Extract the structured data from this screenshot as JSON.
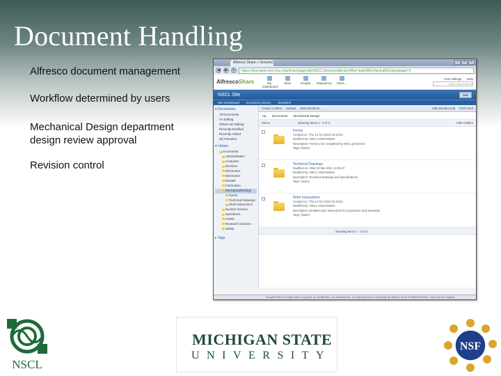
{
  "slide": {
    "title": "Document Handling",
    "bullets": [
      "Alfresco document management",
      "Workflow determined by users",
      "Mechanical Design department design review approval",
      "Revision control"
    ]
  },
  "screenshot": {
    "browser_tab": "Alfresco Share » Docume...",
    "address": "https://docmgmt.nscl.msu.edu/share/page/site/NSCL/documentlibrary#filter=path|/Mechanical/Design&page=1",
    "app_logo": "Alfresco",
    "app_logo_accent": "Share",
    "app_nav": [
      "My Dashboard",
      "Sites",
      "People",
      "Repository",
      "More..."
    ],
    "user_label": "chris stillings",
    "help_label": "Help",
    "search_placeholder": "Enter search terms",
    "site_title": "NSCL Site",
    "join_label": "Join",
    "site_nav": [
      "Site Dashboard",
      "Document Library",
      "Members"
    ],
    "sidebar": {
      "documents_header": "Documents",
      "documents_items": [
        "All Documents",
        "I'm Editing",
        "Others are Editing",
        "Recently Modified",
        "Recently Added",
        "My Favorites"
      ],
      "library_header": "Library",
      "library_items": [
        "Documents",
        "Administration",
        "Computer",
        "Directive",
        "Electronics",
        "Electronics",
        "ESH&E",
        "Fabrication",
        "Mechanical/Design",
        "Forms",
        "Technical Drawings",
        "Work Instructions",
        "Nuclear Science",
        "Operations",
        "OVPR",
        "Research Services",
        "Safety"
      ],
      "tags_header": "Tags"
    },
    "toolbar": [
      "Create Content",
      "Upload",
      "Selected Items...",
      "Hide Breadcrumb",
      "RSS Feed"
    ],
    "crumb": [
      "Up",
      "Documents",
      "Mechanical Design"
    ],
    "pager_top": {
      "left": "Select",
      "center": "Showing items 1 - 3 of 3",
      "right": "Hide Folders"
    },
    "documents": [
      {
        "name": "Forms",
        "created": "Created on: Thu 14 Oct 2010 10:19:03",
        "modified": "Modified by: NSCL Administrator",
        "description": "Description: Forms to be completed by NSCL personnel",
        "tags": "Tags: (None)"
      },
      {
        "name": "Technical Drawings",
        "created": "Modified on: Wed 23 Mar 2011 14:55:47",
        "modified": "Modified by: NSCL Administrator",
        "description": "Description: Technical drawings and specifications",
        "tags": "Tags: (None)"
      },
      {
        "name": "Work Instructions",
        "created": "Created on: Thu 14 Oct 2010 10:19:03",
        "modified": "Modified by: NSCL Administrator",
        "description": "Description: Detailed work instructions for production and assembly",
        "tags": "Tags: (None)"
      }
    ],
    "pager_bottom": "Showing items 1 - 3 of 3",
    "status_bar": "Supplied free of charge with no support, no certification, no maintenance, no warranty and no indemnity by Alfresco or its Certified Partners. Click here for support."
  },
  "logos": {
    "nscl": "NSCL",
    "msu_line1": "MICHIGAN STATE",
    "msu_line2": "UNIVERSITY",
    "nsf": "NSF"
  }
}
